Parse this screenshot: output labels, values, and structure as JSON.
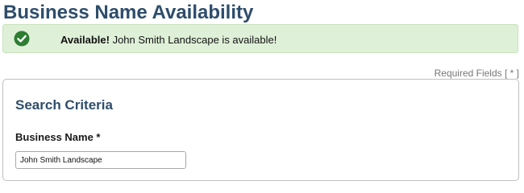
{
  "page": {
    "title": "Business Name Availability"
  },
  "alert": {
    "icon": "check-circle-icon",
    "icon_color": "#2e7d32",
    "background": "#dff0d8",
    "strong_text": "Available!",
    "message": "John Smith Landscape is available!"
  },
  "form": {
    "required_note": "Required Fields [ * ]",
    "section_title": "Search Criteria",
    "business_name": {
      "label": "Business Name *",
      "value": "John Smith Landscape",
      "placeholder": ""
    }
  },
  "colors": {
    "heading": "#2e4d6b",
    "success_bg": "#dff0d8",
    "success_icon": "#2e7d32"
  }
}
